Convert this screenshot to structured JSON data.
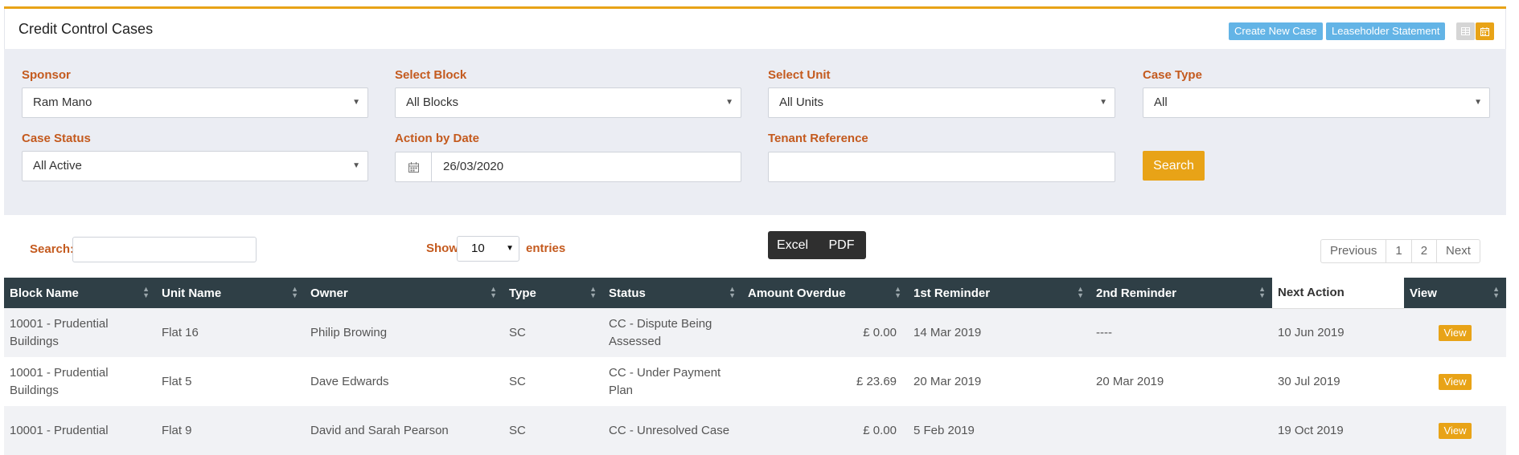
{
  "header": {
    "title": "Credit Control Cases",
    "create_label": "Create New Case",
    "statement_label": "Leaseholder Statement",
    "grid_icon": "table-icon",
    "calendar_icon": "calendar-icon"
  },
  "filters": {
    "sponsor": {
      "label": "Sponsor",
      "value": "Ram Mano"
    },
    "block": {
      "label": "Select Block",
      "value": "All Blocks"
    },
    "unit": {
      "label": "Select Unit",
      "value": "All Units"
    },
    "case_type": {
      "label": "Case Type",
      "value": "All"
    },
    "case_status": {
      "label": "Case Status",
      "value": "All Active"
    },
    "action_date": {
      "label": "Action by Date",
      "value": "26/03/2020"
    },
    "tenant_ref": {
      "label": "Tenant Reference",
      "value": ""
    },
    "search_label": "Search"
  },
  "controls": {
    "search_label": "Search:",
    "show_label": "Show",
    "entries_value": "10",
    "entries_label": "entries",
    "excel_label": "Excel",
    "pdf_label": "PDF",
    "prev_label": "Previous",
    "page1": "1",
    "page2": "2",
    "next_label": "Next"
  },
  "table": {
    "columns": [
      "Block Name",
      "Unit Name",
      "Owner",
      "Type",
      "Status",
      "Amount Overdue",
      "1st Reminder",
      "2nd Reminder",
      "Next Action",
      "View"
    ],
    "rows": [
      {
        "block": "10001 - Prudential Buildings",
        "unit": "Flat 16",
        "owner": "Philip Browing",
        "type": "SC",
        "status": "CC - Dispute Being Assessed",
        "amount": "£ 0.00",
        "r1": "14 Mar 2019",
        "r2": "----",
        "next": "10 Jun 2019",
        "view": "View"
      },
      {
        "block": "10001 - Prudential Buildings",
        "unit": "Flat 5",
        "owner": "Dave Edwards",
        "type": "SC",
        "status": "CC - Under Payment Plan",
        "amount": "£ 23.69",
        "r1": "20 Mar 2019",
        "r2": "20 Mar 2019",
        "next": "30 Jul 2019",
        "view": "View"
      },
      {
        "block": "10001 - Prudential",
        "unit": "Flat 9",
        "owner": "David and Sarah Pearson",
        "type": "SC",
        "status": "CC - Unresolved Case",
        "amount": "£ 0.00",
        "r1": "5 Feb 2019",
        "r2": "",
        "next": "19 Oct 2019",
        "view": "View"
      }
    ]
  }
}
